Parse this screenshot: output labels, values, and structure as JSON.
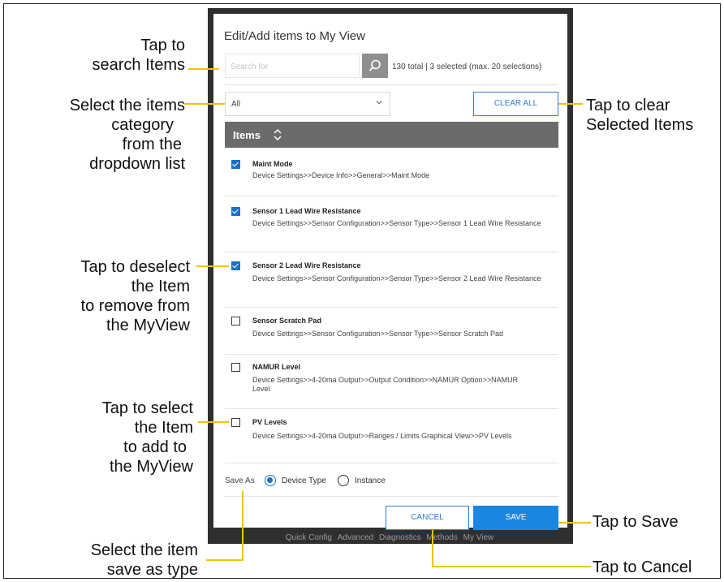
{
  "dialog": {
    "title": "Edit/Add items to My View",
    "search_placeholder": "Search for",
    "count_text": "130 total | 3 selected (max. 20 selections)",
    "category_value": "All",
    "clear_all_label": "CLEAR ALL",
    "items_header": "Items",
    "items": [
      {
        "title": "Maint Mode",
        "path": "Device Settings>>Device Info>>General>>Maint Mode",
        "checked": true
      },
      {
        "title": "Sensor 1 Lead Wire Resistance",
        "path": "Device Settings>>Sensor Configuration>>Sensor Type>>Sensor 1 Lead Wire Resistance",
        "checked": true
      },
      {
        "title": "Sensor 2 Lead Wire Resistance",
        "path": "Device Settings>>Sensor Configuration>>Sensor Type>>Sensor 2 Lead Wire Resistance",
        "checked": true
      },
      {
        "title": "Sensor Scratch Pad",
        "path": "Device Settings>>Sensor Configuration>>Sensor Type>>Sensor Scratch Pad",
        "checked": false
      },
      {
        "title": "NAMUR Level",
        "path": "Device Settings>>4-20ma Output>>Output Condition>>NAMUR Option>>NAMUR Level",
        "checked": false
      },
      {
        "title": "PV Levels",
        "path": "Device Settings>>4-20ma Output>>Ranges / Limits Graphical View>>PV Levels",
        "checked": false
      }
    ],
    "save_as_label": "Save As",
    "save_as_options": [
      "Device Type",
      "Instance"
    ],
    "save_as_selected": "Device Type",
    "cancel_label": "CANCEL",
    "save_label": "SAVE"
  },
  "device_bottom_tabs": [
    "Quick Config",
    "Advanced",
    "Diagnostics",
    "Methods",
    "My View"
  ],
  "callouts": {
    "search": [
      "Tap to",
      "search Items"
    ],
    "category": [
      "Select the items",
      "category",
      "from the",
      "dropdown list"
    ],
    "clear": [
      "Tap to clear",
      "Selected Items"
    ],
    "deselect": [
      "Tap to deselect",
      "the Item",
      "to remove from",
      "the MyView"
    ],
    "select": [
      "Tap to select",
      "the Item",
      "to add to",
      "the MyView"
    ],
    "save_as": [
      "Select the item",
      "save as type"
    ],
    "save": "Tap to Save",
    "cancel": "Tap to Cancel"
  },
  "colors": {
    "accent": "#1a86e0",
    "leader": "#f0c400",
    "header": "#6b6b6b"
  }
}
